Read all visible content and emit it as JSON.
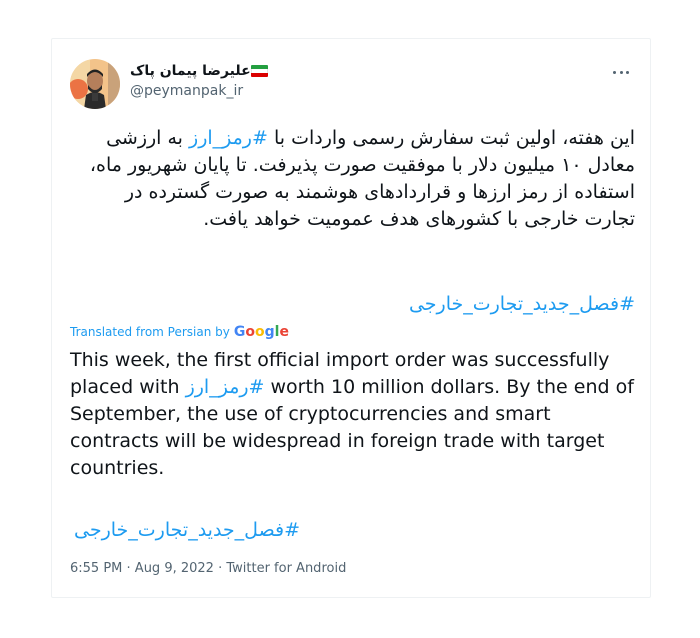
{
  "tweet": {
    "author_name": "علیرضا پیمان پاک",
    "handle": "@peymanpak_ir",
    "text_before_tag": "این هفته، اولین ثبت سفارش رسمی واردات با ",
    "inline_tag": "#رمز_ارز",
    "text_after_tag": " به ارزشی معادل ۱۰ میلیون دلار با موفقیت صورت پذیرفت. تا پایان شهریور ماه، استفاده از رمز ارزها و قراردادهای هوشمند به صورت گسترده در تجارت خارجی با کشورهای هدف عمومیت خواهد یافت.",
    "hashtag": "#فصل_جدید_تجارت_خارجی"
  },
  "translation": {
    "label": "Translated from Persian by",
    "provider": "Google",
    "text_before_tag": "This week, the first official import order was successfully placed with ",
    "inline_tag": "#رمز_ارز",
    "text_after_tag": " worth 10 million dollars. By the end of September, the use of cryptocurrencies and smart contracts will be widespread in foreign trade with target countries.",
    "hashtag": "#فصل_جدید_تجارت_خارجی"
  },
  "meta": {
    "time": "6:55 PM",
    "separator1": " · ",
    "date": "Aug 9, 2022",
    "separator2": " · ",
    "source": "Twitter for Android"
  },
  "icons": {
    "more": "more-icon",
    "flag": "iran-flag-icon"
  },
  "colors": {
    "link": "#1d9bf0",
    "text": "#0f1419",
    "secondary": "#536471"
  }
}
